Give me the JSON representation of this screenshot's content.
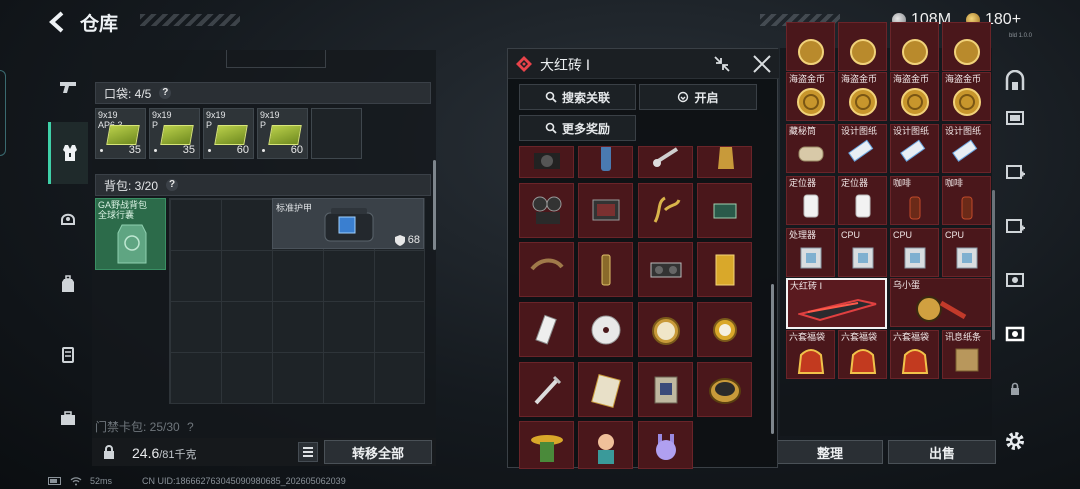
{
  "header": {
    "title": "仓库",
    "currency_1": "108M",
    "currency_2": "180+",
    "version": "bld 1.0.0"
  },
  "pocket": {
    "label": "口袋: 4/5",
    "help": "?",
    "slots": [
      {
        "name_line1": "9x19",
        "name_line2": "AP6.3",
        "count": "35"
      },
      {
        "name_line1": "9x19",
        "name_line2": "P",
        "count": "35"
      },
      {
        "name_line1": "9x19",
        "name_line2": "P",
        "count": "60"
      },
      {
        "name_line1": "9x19",
        "name_line2": "P",
        "count": "60"
      }
    ]
  },
  "backpack": {
    "label": "背包: 3/20",
    "help": "?",
    "bag_name_line1": "GA野战背包",
    "bag_name_line2": "全球行囊",
    "armor_name": "标准护甲",
    "armor_durability": "68"
  },
  "keycard": {
    "label": "门禁卡包: 25/30",
    "help": "?"
  },
  "footer": {
    "weight": "24.6",
    "weight_cap": "/81千克",
    "transfer_all": "转移全部",
    "sort": "整理",
    "sell": "出售"
  },
  "popup": {
    "title": "大红砖 Ⅰ",
    "search_assoc": "搜索关联",
    "open": "开启",
    "more_rewards": "更多奖励"
  },
  "right_items": [
    [
      "",
      "",
      "",
      ""
    ],
    [
      "海盗金币",
      "海盗金币",
      "海盗金币",
      "海盗金币"
    ],
    [
      "藏秘筒",
      "设计图纸",
      "设计图纸",
      "设计图纸"
    ],
    [
      "定位器",
      "定位器",
      "咖啡",
      "咖啡"
    ],
    [
      "处理器",
      "CPU",
      "CPU",
      "CPU"
    ],
    [
      "大红砖 Ⅰ",
      "",
      "乌小蛋",
      ""
    ],
    [
      "六套福袋",
      "六套福袋",
      "六套福袋",
      "讯息纸条"
    ]
  ],
  "status": {
    "ping": "52ms",
    "uid": "CN UID:186662763045090980685_202605062039"
  },
  "colors": {
    "accent": "#3fd0a8",
    "item_red": "#4a171b",
    "popup_logo": "#e8434a"
  }
}
